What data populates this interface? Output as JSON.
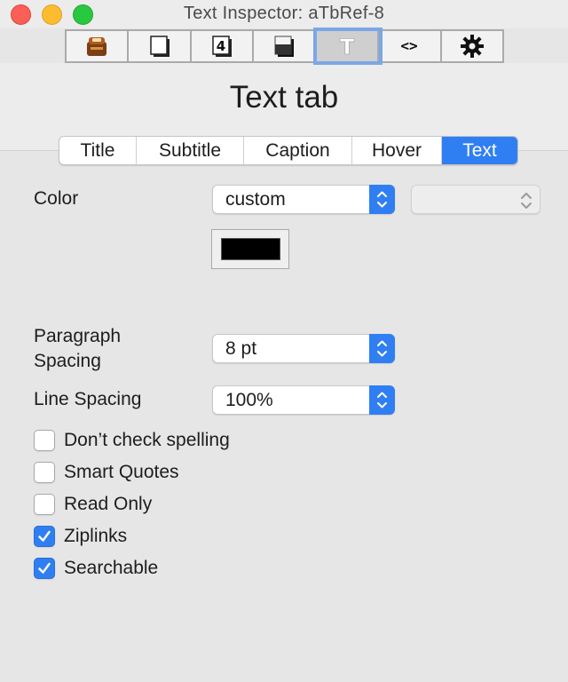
{
  "window": {
    "title": "Text Inspector: aTbRef-8"
  },
  "toolbar": {
    "buttons": [
      {
        "icon": "general-inspector-icon"
      },
      {
        "icon": "appearance-inspector-icon"
      },
      {
        "icon": "properties-inspector-icon"
      },
      {
        "icon": "shadow-inspector-icon"
      },
      {
        "icon": "text-inspector-icon",
        "label": "T",
        "selected": true
      },
      {
        "icon": "code-inspector-icon",
        "label": "<>"
      },
      {
        "icon": "action-inspector-icon"
      }
    ]
  },
  "page": {
    "heading": "Text tab"
  },
  "tabs": [
    {
      "label": "Title",
      "active": false
    },
    {
      "label": "Subtitle",
      "active": false
    },
    {
      "label": "Caption",
      "active": false
    },
    {
      "label": "Hover",
      "active": false
    },
    {
      "label": "Text",
      "active": true
    }
  ],
  "form": {
    "color_label": "Color",
    "color_value": "custom",
    "color_secondary_value": "",
    "swatch_color": "#000000",
    "paragraph_spacing_label": "Paragraph Spacing",
    "paragraph_spacing_line1": "Paragraph",
    "paragraph_spacing_line2": "Spacing",
    "paragraph_spacing_value": "8 pt",
    "line_spacing_label": "Line Spacing",
    "line_spacing_value": "100%"
  },
  "checkboxes": [
    {
      "label": "Don’t check spelling",
      "checked": false
    },
    {
      "label": "Smart Quotes",
      "checked": false
    },
    {
      "label": "Read Only",
      "checked": false
    },
    {
      "label": "Ziplinks",
      "checked": true
    },
    {
      "label": "Searchable",
      "checked": true
    }
  ],
  "colors": {
    "accent": "#2f7ff2",
    "close": "#fc5f57",
    "minimize": "#fdbc2e",
    "zoom": "#28c840"
  }
}
